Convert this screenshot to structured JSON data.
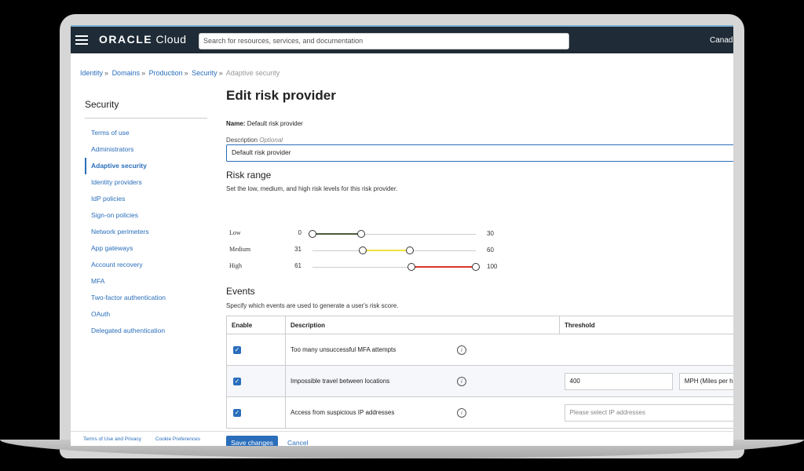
{
  "topbar": {
    "brand_oracle": "ORACLE",
    "brand_cloud": "Cloud",
    "search_placeholder": "Search for resources, services, and documentation",
    "region": "Canada"
  },
  "breadcrumb": [
    "Identity",
    "Domains",
    "Production",
    "Security",
    "Adaptive security"
  ],
  "sidebar": {
    "title": "Security",
    "items": [
      {
        "label": "Terms of use"
      },
      {
        "label": "Administrators"
      },
      {
        "label": "Adaptive security",
        "active": true
      },
      {
        "label": "Identity providers"
      },
      {
        "label": "IdP policies"
      },
      {
        "label": "Sign-on policies"
      },
      {
        "label": "Network perimeters"
      },
      {
        "label": "App gateways"
      },
      {
        "label": "Account recovery"
      },
      {
        "label": "MFA"
      },
      {
        "label": "Two-factor authentication"
      },
      {
        "label": "OAuth"
      },
      {
        "label": "Delegated authentication"
      }
    ]
  },
  "main": {
    "title": "Edit risk provider",
    "name_label": "Name:",
    "name_value": "Default risk provider",
    "description_label": "Description",
    "description_optional": "Optional",
    "description_value": "Default risk provider",
    "risk_range": {
      "title": "Risk range",
      "subtitle": "Set the low, medium, and high risk levels for this risk provider.",
      "levels": [
        {
          "label": "Low",
          "min": "0",
          "max": "30",
          "color": "#4a5a3a"
        },
        {
          "label": "Medium",
          "min": "31",
          "max": "60",
          "color": "#f2e23a"
        },
        {
          "label": "High",
          "min": "61",
          "max": "100",
          "color": "#d9342b"
        }
      ]
    },
    "events": {
      "title": "Events",
      "subtitle": "Specify which events are used to generate a user's risk score.",
      "headers": [
        "Enable",
        "Description",
        "Threshold"
      ],
      "rows": [
        {
          "enabled": true,
          "description": "Too many unsuccessful MFA attempts"
        },
        {
          "enabled": true,
          "description": "Impossible travel between locations",
          "threshold_value": "400",
          "unit": "MPH (Miles per h"
        },
        {
          "enabled": true,
          "description": "Access from suspicious IP addresses",
          "threshold_placeholder": "Please select IP addresses"
        }
      ]
    },
    "save_label": "Save changes",
    "cancel_label": "Cancel"
  },
  "footer": {
    "terms": "Terms of Use and Privacy",
    "cookies": "Cookie Preferences"
  }
}
